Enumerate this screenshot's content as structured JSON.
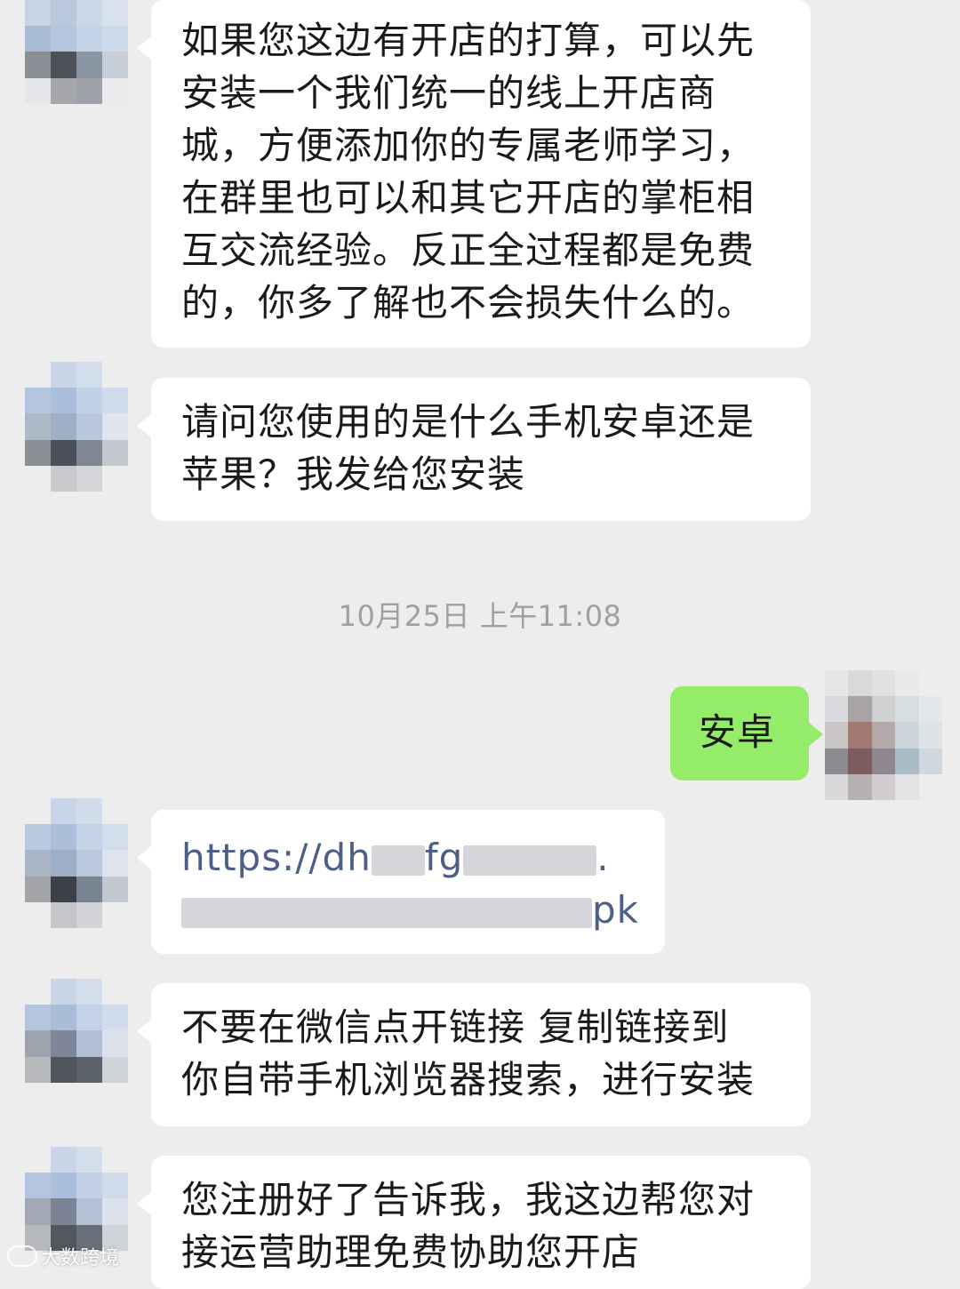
{
  "chat": {
    "timestamp": "10月25日 上午11:08",
    "messages": [
      {
        "side": "left",
        "lines": [
          "如果您这边有开店的打算，可以先",
          "安装一个我们统一的线上开店商",
          "城，方便添加你的专属老师学习，",
          "在群里也可以和其它开店的掌柜相",
          "互交流经验。反正全过程都是免费",
          "的，你多了解也不会损失什么的。"
        ]
      },
      {
        "side": "left",
        "lines": [
          "请问您使用的是什么手机安卓还是",
          "苹果？我发给您安装"
        ]
      },
      {
        "side": "right",
        "lines": [
          "安卓"
        ]
      },
      {
        "side": "left",
        "type": "link",
        "link_start": "https://dh",
        "link_mid": "fg",
        "link_dot": ".",
        "link_end": "pk"
      },
      {
        "side": "left",
        "lines": [
          "不要在微信点开链接  复制链接到",
          "你自带手机浏览器搜索，进行安装"
        ]
      },
      {
        "side": "left",
        "lines": [
          "您注册好了告诉我，我这边帮您对",
          "接运营助理免费协助您开店"
        ]
      }
    ]
  },
  "watermark": {
    "text": "大数跨境",
    "logo_icon": "speech-logo-icon"
  },
  "colors": {
    "background": "#ededed",
    "bubble_left": "#ffffff",
    "bubble_right": "#95ec69",
    "timestamp": "#a0a0a0",
    "link": "#4d5f87"
  }
}
